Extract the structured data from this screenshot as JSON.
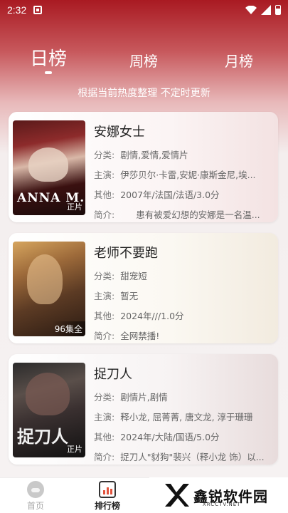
{
  "status_bar": {
    "time": "2:32"
  },
  "tabs": [
    {
      "label": "日榜",
      "active": true
    },
    {
      "label": "周榜",
      "active": false
    },
    {
      "label": "月榜",
      "active": false
    }
  ],
  "subtitle": "根据当前热度整理 不定时更新",
  "cards": [
    {
      "title": "安娜女士",
      "genre_label": "分类:",
      "genre": "剧情,爱情,爱情片",
      "cast_label": "主演:",
      "cast": "伊莎贝尔·卡雷,安妮·康斯金尼,埃...",
      "other_label": "其他:",
      "other": "2007年/法国/法语/3.0分",
      "intro_label": "简介:",
      "intro": "患有被爱幻想的安娜是一名温...",
      "poster_text": "ANNA M.",
      "poster_badge": "正片"
    },
    {
      "title": "老师不要跑",
      "genre_label": "分类:",
      "genre": "甜宠短",
      "cast_label": "主演:",
      "cast": "暂无",
      "other_label": "其他:",
      "other": "2024年///1.0分",
      "intro_label": "简介:",
      "intro": "全网禁播!",
      "poster_badge": "96集全"
    },
    {
      "title": "捉刀人",
      "genre_label": "分类:",
      "genre": "剧情片,剧情",
      "cast_label": "主演:",
      "cast": "释小龙, 屈菁菁, 唐文龙, 淳于珊珊",
      "other_label": "其他:",
      "other": "2024年/大陆/国语/5.0分",
      "intro_label": "简介:",
      "intro": "捉刀人\"豺狗\"裴兴（释小龙 饰）以...",
      "poster_text": "捉刀人",
      "poster_badge": "正片"
    }
  ],
  "bottom_nav": [
    {
      "label": "首页",
      "icon": "home-icon"
    },
    {
      "label": "排行榜",
      "icon": "ranking-icon"
    }
  ],
  "watermark": {
    "text": "鑫锐软件园",
    "url": "XRCCTV.NET"
  }
}
